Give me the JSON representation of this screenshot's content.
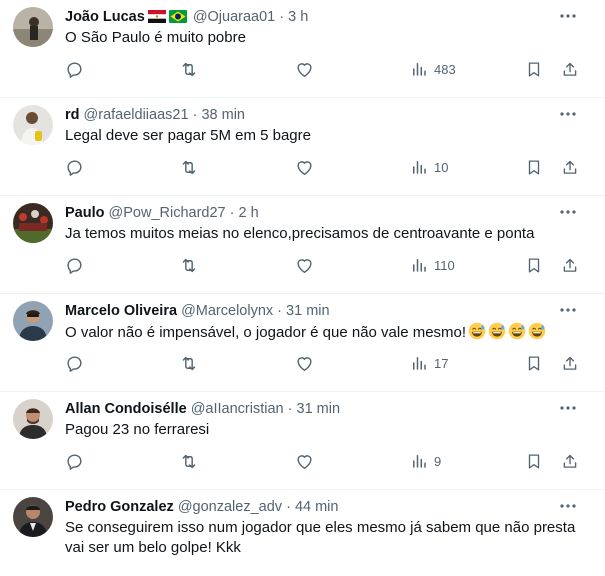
{
  "tweets": [
    {
      "name": "João Lucas",
      "handle": "@Ojuaraa01",
      "dot": "·",
      "time": "3 h",
      "flags": [
        "egypt-flag",
        "brazil-flag"
      ],
      "text": "O São Paulo é muito pobre",
      "views": "483"
    },
    {
      "name": "rd",
      "handle": "@rafaeldiiaas21",
      "dot": "·",
      "time": "38 min",
      "text": "Legal deve ser pagar 5M em 5 bagre",
      "views": "10"
    },
    {
      "name": "Paulo",
      "handle": "@Pow_Richard27",
      "dot": "·",
      "time": "2 h",
      "text": "Ja temos muitos meias no elenco,precisamos de centroavante e ponta",
      "views": "110"
    },
    {
      "name": "Marcelo Oliveira",
      "handle": "@Marcelolynx",
      "dot": "·",
      "time": "31 min",
      "text": "O valor não é impensável, o jogador é que não vale mesmo!",
      "emoji_count": 4,
      "emoji_icon": "grinning-sweat-emoji",
      "views": "17"
    },
    {
      "name": "Allan Condoisélle",
      "handle": "@aIIancristian",
      "dot": "·",
      "time": "31 min",
      "text": "Pagou 23 no ferraresi",
      "views": "9"
    },
    {
      "name": "Pedro Gonzalez",
      "handle": "@gonzalez_adv",
      "dot": "·",
      "time": "44 min",
      "text": "Se conseguirem isso num jogador que eles mesmo já sabem que não presta vai ser um belo golpe! Kkk"
    }
  ],
  "icons": {
    "reply": "reply-icon",
    "retweet": "retweet-icon",
    "like": "like-icon",
    "views": "views-icon",
    "bookmark": "bookmark-icon",
    "share": "share-icon",
    "more": "more-icon"
  },
  "colors": {
    "text": "#0f1419",
    "secondary": "#536471",
    "divider": "#eff3f4"
  }
}
